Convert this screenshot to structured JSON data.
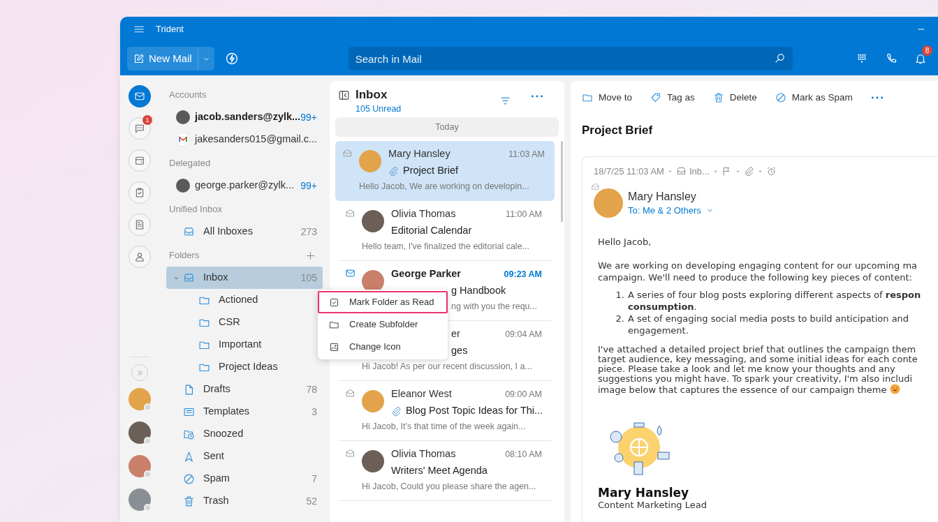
{
  "window": {
    "title": "Trident"
  },
  "toolbar": {
    "new_mail": "New Mail",
    "search": {
      "placeholder": "Search in Mail"
    },
    "notification_badge": "8"
  },
  "rail": {
    "items": [
      {
        "kind": "mail",
        "selected": true
      },
      {
        "kind": "chat",
        "selected": false,
        "badge": "1"
      },
      {
        "kind": "calendar",
        "selected": false
      },
      {
        "kind": "tasks",
        "selected": false
      },
      {
        "kind": "notes",
        "selected": false
      },
      {
        "kind": "contacts",
        "selected": false
      }
    ]
  },
  "sidebar": {
    "sections": [
      {
        "label": "Accounts",
        "items": [
          {
            "kind": "account",
            "label": "jacob.sanders@zylk...",
            "count": "99+",
            "unread": true
          },
          {
            "kind": "gmail-account",
            "label": "jakesanders015@gmail.c...",
            "unread": false
          }
        ]
      },
      {
        "label": "Delegated",
        "items": [
          {
            "kind": "account",
            "label": "george.parker@zylk...",
            "count": "99+",
            "unread": false
          }
        ]
      },
      {
        "label": "Unified Inbox",
        "items": [
          {
            "kind": "inbox",
            "label": "All Inboxes",
            "count": "273",
            "selected": false
          }
        ]
      },
      {
        "label": "Folders",
        "add": true,
        "items": [
          {
            "kind": "inbox",
            "label": "Inbox",
            "count": "105",
            "selected": true,
            "expanded": true,
            "children": [
              {
                "kind": "folder",
                "label": "Actioned",
                "selected": false
              },
              {
                "kind": "folder",
                "label": "CSR",
                "selected": false
              },
              {
                "kind": "folder",
                "label": "Important",
                "selected": false
              },
              {
                "kind": "folder",
                "label": "Project Ideas",
                "selected": false
              }
            ]
          },
          {
            "kind": "drafts",
            "label": "Drafts",
            "count": "78",
            "selected": false
          },
          {
            "kind": "templates",
            "label": "Templates",
            "count": "3",
            "selected": false
          },
          {
            "kind": "snoozed",
            "label": "Snoozed",
            "selected": false
          },
          {
            "kind": "sent",
            "label": "Sent",
            "selected": false
          },
          {
            "kind": "spam",
            "label": "Spam",
            "count": "7",
            "selected": false
          },
          {
            "kind": "trash",
            "label": "Trash",
            "count": "52",
            "selected": false
          }
        ]
      }
    ]
  },
  "mail_list": {
    "title": "Inbox",
    "unread": "105 Unread",
    "group": "Today",
    "items": [
      {
        "sender": "Mary Hansley",
        "time": "11:03 AM",
        "subject": "Project Brief",
        "preview": "Hello Jacob, We are working on developin...",
        "attachment": true,
        "unread": false,
        "selected": true,
        "kind": "plain"
      },
      {
        "sender": "Olivia Thomas",
        "time": "11:00 AM",
        "subject": "Editorial Calendar",
        "preview": "Hello team, I've finalized the editorial cale...",
        "attachment": false,
        "unread": false,
        "selected": false,
        "kind": "plain"
      },
      {
        "sender": "George Parker",
        "time": "09:23 AM",
        "subject": "g Handbook",
        "preview": "ng with you the requ...",
        "attachment": false,
        "unread": true,
        "selected": false,
        "kind": "lower-covered"
      },
      {
        "sender": "er",
        "time": "09:04 AM",
        "subject": "ges",
        "preview": "Hi Jacob! As per our recent discussion, I a...",
        "attachment": false,
        "unread": false,
        "selected": false,
        "kind": "upper-covered"
      },
      {
        "sender": "Eleanor West",
        "time": "09:00 AM",
        "subject": "Blog Post Topic Ideas for Thi...",
        "preview": "Hi Jacob, It's that time of the week again...",
        "attachment": true,
        "unread": false,
        "selected": false,
        "kind": "plain"
      },
      {
        "sender": "Olivia Thomas",
        "time": "08:10 AM",
        "subject": "Writers' Meet Agenda",
        "preview": "Hi Jacob, Could you please share the agen...",
        "attachment": false,
        "unread": false,
        "selected": false,
        "kind": "plain"
      }
    ]
  },
  "context_menu": {
    "items": [
      {
        "kind": "mark-read",
        "label": "Mark Folder as Read",
        "highlighted": true
      },
      {
        "kind": "subfolder",
        "label": "Create Subfolder",
        "highlighted": false
      },
      {
        "kind": "change-icon",
        "label": "Change Icon",
        "highlighted": false
      }
    ]
  },
  "reader": {
    "actions": [
      {
        "kind": "move",
        "label": "Move to"
      },
      {
        "kind": "tag",
        "label": "Tag as"
      },
      {
        "kind": "delete",
        "label": "Delete"
      },
      {
        "kind": "spam",
        "label": "Mark as Spam"
      }
    ],
    "subject": "Project Brief",
    "date": "18/7/25 11:03 AM",
    "folder": "Inb...",
    "sender": "Mary Hansley",
    "recipients": "To: Me & 2 Others",
    "body": {
      "greeting": "Hello Jacob,",
      "intro": [
        "We are working on developing engaging content for our upcoming ma",
        "campaign. We'll need to produce the following key pieces of content:"
      ],
      "list": [
        {
          "number": "1.",
          "lines": [
            "A series of four blog posts exploring different aspects of **respon**",
            "**consumption**."
          ]
        },
        {
          "number": "2.",
          "lines": [
            "A set of engaging social media posts to build anticipation and",
            "engagement."
          ]
        }
      ],
      "closing": [
        "I've attached a detailed project brief that outlines the campaign them",
        "target audience, key messaging, and some initial ideas for each conte",
        "piece. Please take a look and let me know your thoughts and any",
        "suggestions you might have. To spark your creativity, I'm also includi",
        "image below that captures the essence of our campaign theme"
      ],
      "signature_name": "Mary Hansley",
      "signature_title": "Content Marketing Lead"
    }
  }
}
